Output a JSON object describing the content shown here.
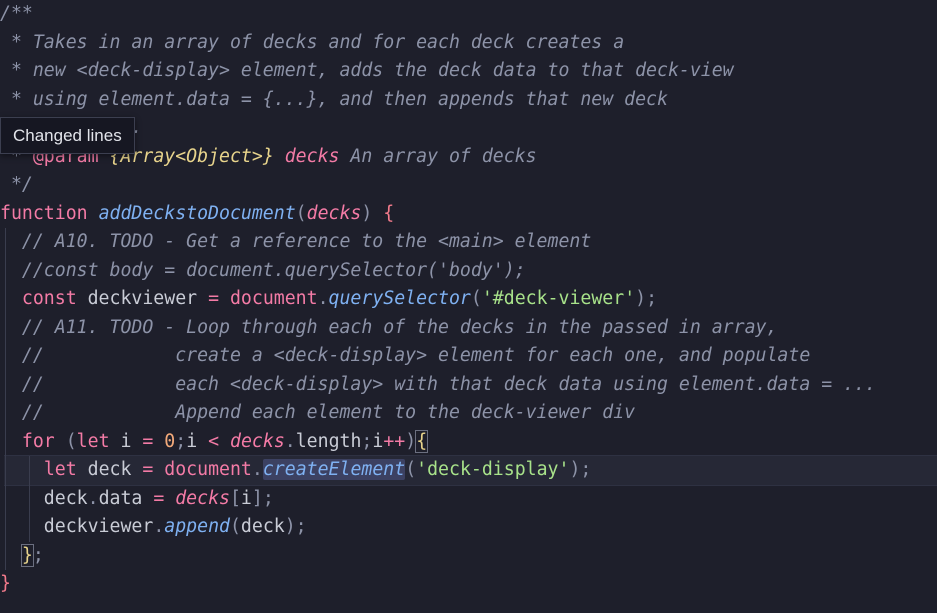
{
  "tooltip": {
    "text": "Changed lines"
  },
  "lines": [
    [
      {
        "t": "/**",
        "c": "c-comment"
      }
    ],
    [
      {
        "t": " * Takes in an array of decks and for each deck creates a",
        "c": "c-comment"
      }
    ],
    [
      {
        "t": " * new <deck-display> element, adds the deck data to that deck-view",
        "c": "c-comment"
      }
    ],
    [
      {
        "t": " * using element.data = {...}, and then appends that new deck",
        "c": "c-comment"
      }
    ],
    [
      {
        "t": " * to the ...",
        "c": "c-comment"
      }
    ],
    [
      {
        "t": " * ",
        "c": "c-comment"
      },
      {
        "t": "@param",
        "c": "c-kw"
      },
      {
        "t": " {",
        "c": "c-type"
      },
      {
        "t": "Array<Object>",
        "c": "c-type"
      },
      {
        "t": "}",
        "c": "c-type"
      },
      {
        "t": " decks",
        "c": "c-param"
      },
      {
        "t": " An array of decks",
        "c": "c-comment"
      }
    ],
    [
      {
        "t": " */",
        "c": "c-comment"
      }
    ],
    [
      {
        "t": "function",
        "c": "c-kw"
      },
      {
        "t": " ",
        "c": "c-plain"
      },
      {
        "t": "addDeckstoDocument",
        "c": "c-fn"
      },
      {
        "t": "(",
        "c": "c-punct"
      },
      {
        "t": "decks",
        "c": "c-param"
      },
      {
        "t": ")",
        "c": "c-punct"
      },
      {
        "t": " ",
        "c": "c-plain"
      },
      {
        "t": "{",
        "c": "c-brace1"
      }
    ],
    [
      {
        "t": "  // A10. TODO - Get a reference to the <main> element",
        "c": "c-comment"
      }
    ],
    [
      {
        "t": "  //const body = document.querySelector('body');",
        "c": "c-comment"
      }
    ],
    [
      {
        "t": "  ",
        "c": "c-plain"
      },
      {
        "t": "const",
        "c": "c-kw"
      },
      {
        "t": " deckviewer ",
        "c": "c-plain"
      },
      {
        "t": "=",
        "c": "c-kw"
      },
      {
        "t": " ",
        "c": "c-plain"
      },
      {
        "t": "document",
        "c": "c-tag"
      },
      {
        "t": ".",
        "c": "c-punct"
      },
      {
        "t": "querySelector",
        "c": "c-fn"
      },
      {
        "t": "(",
        "c": "c-punct"
      },
      {
        "t": "'#deck-viewer'",
        "c": "c-str"
      },
      {
        "t": ");",
        "c": "c-punct"
      }
    ],
    [
      {
        "t": "  // A11. TODO - Loop through each of the decks in the passed in array,",
        "c": "c-comment"
      }
    ],
    [
      {
        "t": "  //            create a <deck-display> element for each one, and populate",
        "c": "c-comment"
      }
    ],
    [
      {
        "t": "  //            each <deck-display> with that deck data using element.data = ...",
        "c": "c-comment"
      }
    ],
    [
      {
        "t": "  //            Append each element to the deck-viewer div",
        "c": "c-comment"
      }
    ],
    [
      {
        "t": "  ",
        "c": "c-plain"
      },
      {
        "t": "for",
        "c": "c-kw"
      },
      {
        "t": " (",
        "c": "c-punct"
      },
      {
        "t": "let",
        "c": "c-kw"
      },
      {
        "t": " i ",
        "c": "c-plain"
      },
      {
        "t": "=",
        "c": "c-kw"
      },
      {
        "t": " ",
        "c": "c-plain"
      },
      {
        "t": "0",
        "c": "c-num"
      },
      {
        "t": ";",
        "c": "c-punct"
      },
      {
        "t": "i ",
        "c": "c-plain"
      },
      {
        "t": "<",
        "c": "c-kw"
      },
      {
        "t": " ",
        "c": "c-plain"
      },
      {
        "t": "decks",
        "c": "c-param"
      },
      {
        "t": ".",
        "c": "c-punct"
      },
      {
        "t": "length",
        "c": "c-plain"
      },
      {
        "t": ";",
        "c": "c-punct"
      },
      {
        "t": "i",
        "c": "c-plain"
      },
      {
        "t": "++",
        "c": "c-kw"
      },
      {
        "t": ")",
        "c": "c-punct"
      },
      {
        "t": "{",
        "c": "c-brace2 bracket-box"
      }
    ],
    [
      {
        "t": "    ",
        "c": "c-plain"
      },
      {
        "t": "let",
        "c": "c-kw"
      },
      {
        "t": " deck ",
        "c": "c-plain"
      },
      {
        "t": "=",
        "c": "c-kw"
      },
      {
        "t": " ",
        "c": "c-plain"
      },
      {
        "t": "document",
        "c": "c-tag"
      },
      {
        "t": ".",
        "c": "c-punct"
      },
      {
        "t": "createElement",
        "c": "c-fn c-sel"
      },
      {
        "t": "(",
        "c": "c-punct"
      },
      {
        "t": "'deck-display'",
        "c": "c-str"
      },
      {
        "t": ");",
        "c": "c-punct"
      }
    ],
    [
      {
        "t": "    deck",
        "c": "c-plain"
      },
      {
        "t": ".",
        "c": "c-punct"
      },
      {
        "t": "data ",
        "c": "c-plain"
      },
      {
        "t": "=",
        "c": "c-kw"
      },
      {
        "t": " ",
        "c": "c-plain"
      },
      {
        "t": "decks",
        "c": "c-param"
      },
      {
        "t": "[",
        "c": "c-punct"
      },
      {
        "t": "i",
        "c": "c-plain"
      },
      {
        "t": "];",
        "c": "c-punct"
      }
    ],
    [
      {
        "t": "    deckviewer",
        "c": "c-plain"
      },
      {
        "t": ".",
        "c": "c-punct"
      },
      {
        "t": "append",
        "c": "c-fn"
      },
      {
        "t": "(",
        "c": "c-punct"
      },
      {
        "t": "deck",
        "c": "c-plain"
      },
      {
        "t": ");",
        "c": "c-punct"
      }
    ],
    [
      {
        "t": "  ",
        "c": "c-plain"
      },
      {
        "t": "}",
        "c": "c-brace2 bracket-box"
      },
      {
        "t": ";",
        "c": "c-punct"
      }
    ],
    [
      {
        "t": "}",
        "c": "c-brace1"
      }
    ]
  ]
}
